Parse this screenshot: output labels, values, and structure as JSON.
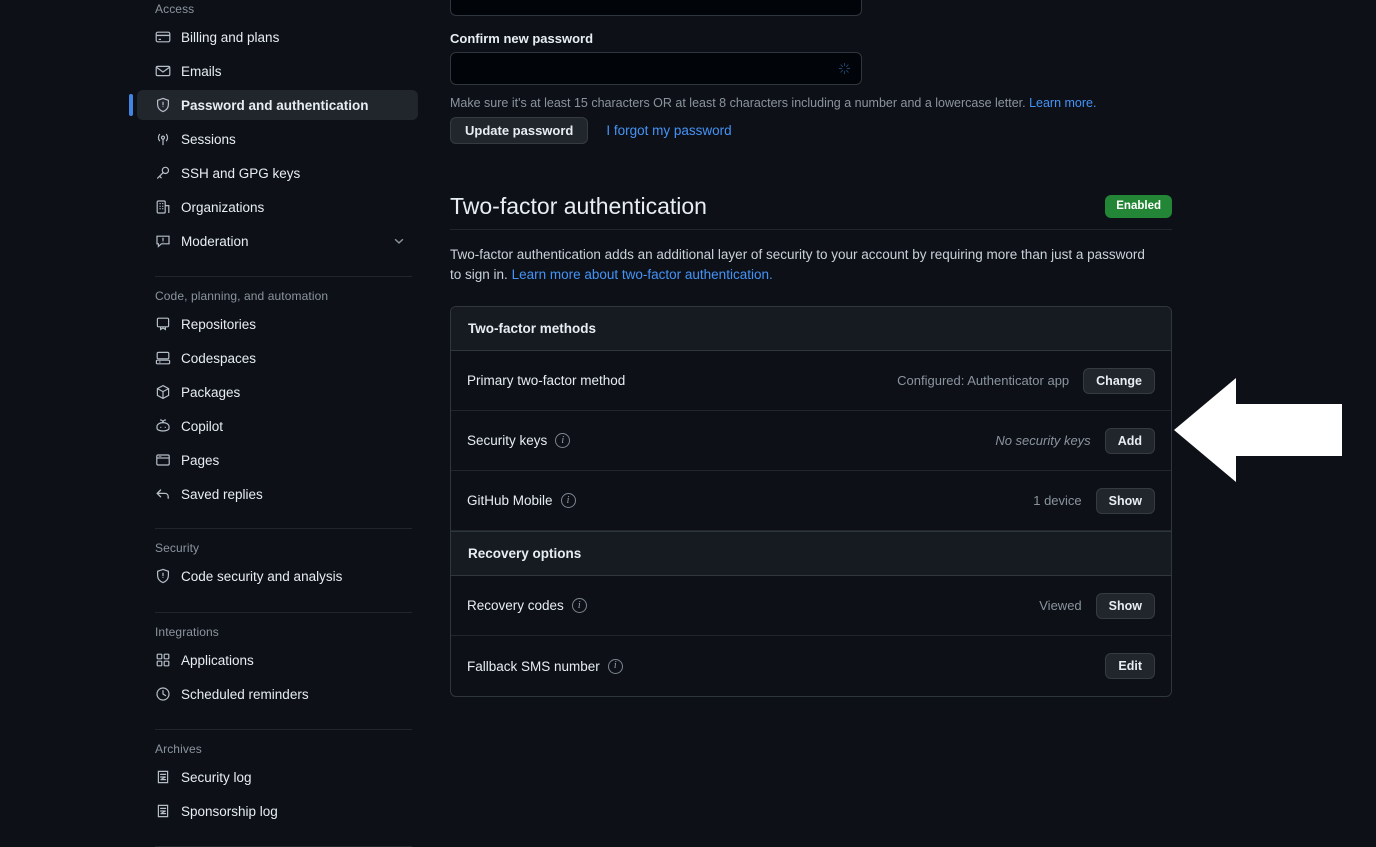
{
  "colors": {
    "background": "#0d1117",
    "accent_blue": "#4184e4",
    "link_blue": "#4493f8",
    "badge_green": "#238636",
    "border": "#30363d",
    "arrow_overlay": "#ffffff"
  },
  "sidebar": {
    "groups": [
      {
        "title": "Access",
        "items": [
          {
            "label": "Billing and plans",
            "icon": "credit-card-icon",
            "active": false
          },
          {
            "label": "Emails",
            "icon": "mail-icon",
            "active": false
          },
          {
            "label": "Password and authentication",
            "icon": "shield-icon",
            "active": true
          },
          {
            "label": "Sessions",
            "icon": "broadcast-icon",
            "active": false
          },
          {
            "label": "SSH and GPG keys",
            "icon": "key-icon",
            "active": false
          },
          {
            "label": "Organizations",
            "icon": "organization-icon",
            "active": false
          },
          {
            "label": "Moderation",
            "icon": "report-icon",
            "active": false,
            "chevron": "chevron-down-icon"
          }
        ]
      },
      {
        "title": "Code, planning, and automation",
        "items": [
          {
            "label": "Repositories",
            "icon": "repo-icon",
            "active": false
          },
          {
            "label": "Codespaces",
            "icon": "codespaces-icon",
            "active": false
          },
          {
            "label": "Packages",
            "icon": "package-icon",
            "active": false
          },
          {
            "label": "Copilot",
            "icon": "copilot-icon",
            "active": false
          },
          {
            "label": "Pages",
            "icon": "browser-icon",
            "active": false
          },
          {
            "label": "Saved replies",
            "icon": "reply-icon",
            "active": false
          }
        ]
      },
      {
        "title": "Security",
        "items": [
          {
            "label": "Code security and analysis",
            "icon": "shield-icon",
            "active": false
          }
        ]
      },
      {
        "title": "Integrations",
        "items": [
          {
            "label": "Applications",
            "icon": "apps-grid-icon",
            "active": false
          },
          {
            "label": "Scheduled reminders",
            "icon": "clock-icon",
            "active": false
          }
        ]
      },
      {
        "title": "Archives",
        "items": [
          {
            "label": "Security log",
            "icon": "log-icon",
            "active": false
          },
          {
            "label": "Sponsorship log",
            "icon": "log-icon",
            "active": false
          }
        ]
      }
    ]
  },
  "password_section": {
    "confirm_label": "Confirm new password",
    "confirm_value": "",
    "confirm_placeholder": "",
    "spinner_icon": "loading-spinner-icon",
    "hint_text": "Make sure it's at least 15 characters OR at least 8 characters including a number and a lowercase letter.",
    "hint_link": "Learn more.",
    "update_button": "Update password",
    "forgot_link": "I forgot my password"
  },
  "two_factor": {
    "title": "Two-factor authentication",
    "badge": "Enabled",
    "description": "Two-factor authentication adds an additional layer of security to your account by requiring more than just a password to sign in.",
    "description_link": "Learn more about two-factor authentication.",
    "methods_header": "Two-factor methods",
    "methods": [
      {
        "label": "Primary two-factor method",
        "has_info": false,
        "status": "Configured: Authenticator app",
        "status_italic": false,
        "button": "Change"
      },
      {
        "label": "Security keys",
        "has_info": true,
        "info_icon": "info-icon",
        "status": "No security keys",
        "status_italic": true,
        "button": "Add"
      },
      {
        "label": "GitHub Mobile",
        "has_info": true,
        "info_icon": "info-icon",
        "status": "1 device",
        "status_italic": false,
        "button": "Show"
      }
    ],
    "recovery_header": "Recovery options",
    "recovery": [
      {
        "label": "Recovery codes",
        "has_info": true,
        "info_icon": "info-icon",
        "status": "Viewed",
        "status_italic": false,
        "button": "Show"
      },
      {
        "label": "Fallback SMS number",
        "has_info": true,
        "info_icon": "info-icon",
        "status": "",
        "status_italic": false,
        "button": "Edit"
      }
    ]
  },
  "annotation": {
    "type": "arrow-left-overlay",
    "points_at": "Add"
  }
}
